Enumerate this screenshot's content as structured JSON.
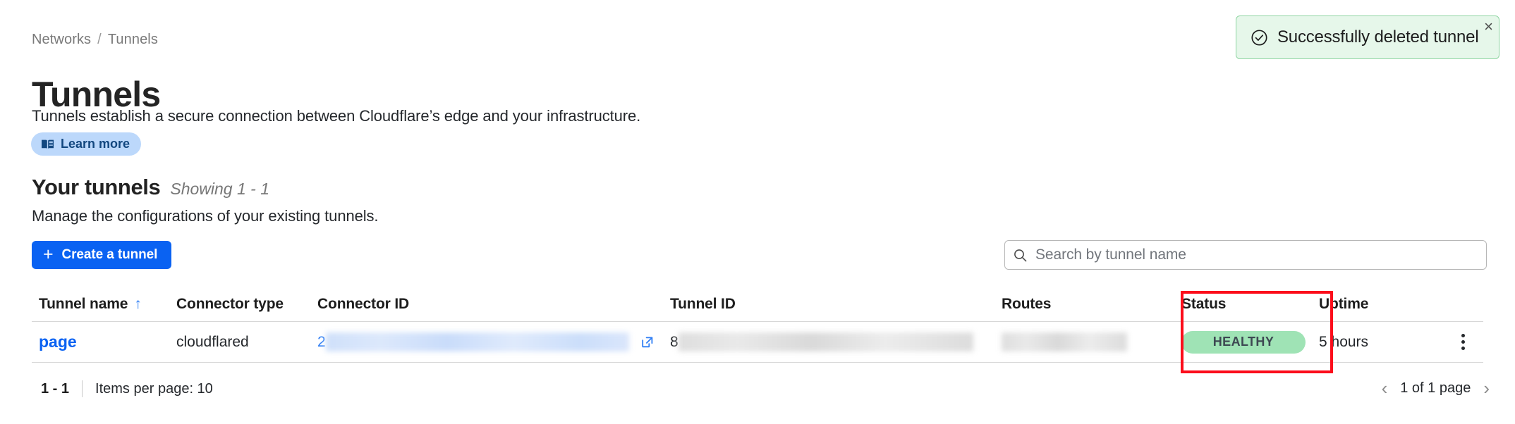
{
  "breadcrumb": {
    "items": [
      "Networks",
      "Tunnels"
    ],
    "separator": "/"
  },
  "page": {
    "title": "Tunnels",
    "intro": "Tunnels establish a secure connection between Cloudflare’s edge and your infrastructure.",
    "learn_more_label": "Learn more"
  },
  "section": {
    "title": "Your tunnels",
    "showing": "Showing 1 - 1",
    "subtitle": "Manage the configurations of your existing tunnels.",
    "create_button_label": "Create a tunnel",
    "create_button_icon": "plus-icon"
  },
  "search": {
    "placeholder": "Search by tunnel name",
    "value": "",
    "icon": "search-icon"
  },
  "table": {
    "columns": [
      {
        "key": "tunnel_name",
        "label": "Tunnel name",
        "sort": "asc",
        "sort_glyph": "↑"
      },
      {
        "key": "connector_type",
        "label": "Connector type"
      },
      {
        "key": "connector_id",
        "label": "Connector ID"
      },
      {
        "key": "tunnel_id",
        "label": "Tunnel ID"
      },
      {
        "key": "routes",
        "label": "Routes"
      },
      {
        "key": "status",
        "label": "Status"
      },
      {
        "key": "uptime",
        "label": "Uptime"
      }
    ],
    "rows": [
      {
        "tunnel_name": "page",
        "connector_type": "cloudflared",
        "connector_id_prefix": "2",
        "connector_id_redacted": true,
        "connector_id_link_icon": "external-link-icon",
        "tunnel_id_prefix": "8",
        "tunnel_id_redacted": true,
        "routes_redacted": true,
        "status": "HEALTHY",
        "uptime": "5 hours",
        "row_menu_icon": "kebab-menu-icon"
      }
    ]
  },
  "footer": {
    "range": "1 - 1",
    "items_per_page": "Items per page: 10",
    "page_indicator": "1 of 1 page",
    "prev_glyph": "‹",
    "next_glyph": "›"
  },
  "toast": {
    "message": "Successfully deleted tunnel",
    "icon": "check-circle-icon",
    "close_glyph": "×",
    "type": "success"
  },
  "annotation": {
    "highlight_target": "status-column",
    "color": "#fc0d1b"
  },
  "colors": {
    "accent_blue": "#0a62f2",
    "link_blue": "#0a62f2",
    "badge_green_bg": "#9fe3b5",
    "toast_bg": "#e6f7ea",
    "toast_border": "#8fd5a2",
    "pill_blue_bg": "#bcd8fb",
    "pill_blue_text": "#12477f",
    "highlight_red": "#fc0d1b"
  }
}
